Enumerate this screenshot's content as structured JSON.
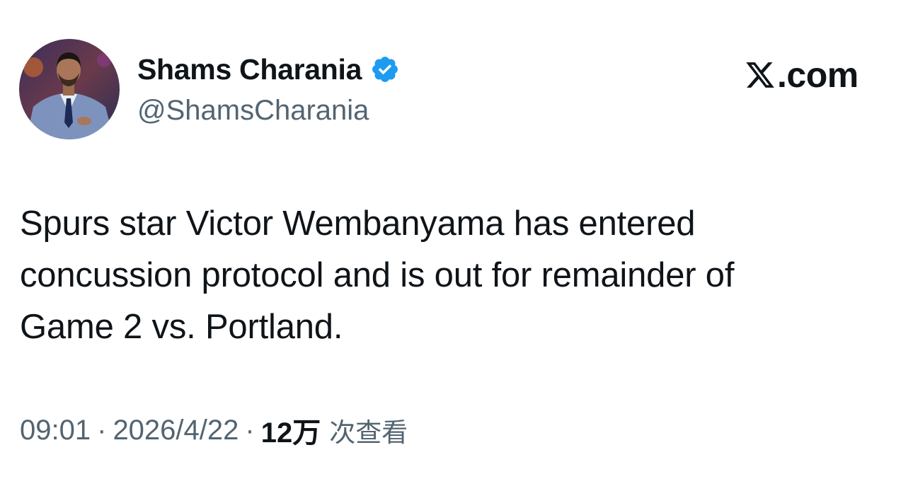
{
  "author": {
    "display_name": "Shams Charania",
    "handle": "@ShamsCharania",
    "verified": true,
    "verified_color": "#1d9bf0"
  },
  "brand": {
    "logo_icon": "x-logo-icon",
    "text": ".com"
  },
  "tweet": {
    "lines": [
      "Spurs star Victor Wembanyama has entered",
      "concussion protocol and is out for remainder of",
      "Game 2 vs. Portland."
    ]
  },
  "meta": {
    "time": "09:01",
    "separator": "·",
    "date": "2026/4/22",
    "views_count": "12万",
    "views_label": "次查看"
  },
  "colors": {
    "text_primary": "#0f1419",
    "text_secondary": "#536471",
    "background": "#ffffff"
  }
}
